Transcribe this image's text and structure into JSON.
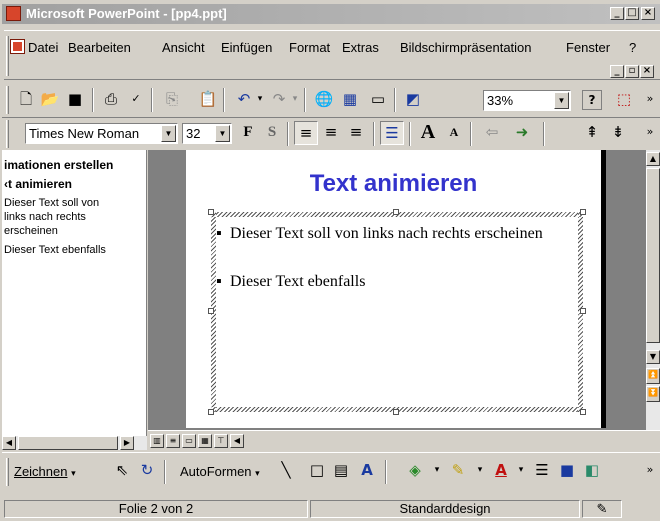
{
  "window": {
    "title": "Microsoft PowerPoint - [pp4.ppt]"
  },
  "menu": [
    {
      "label": "Datei"
    },
    {
      "label": "Bearbeiten"
    },
    {
      "label": "Ansicht"
    },
    {
      "label": "Einfügen"
    },
    {
      "label": "Format"
    },
    {
      "label": "Extras"
    },
    {
      "label": "Bildschirmpräsentation"
    },
    {
      "label": "Fenster"
    },
    {
      "label": "?"
    }
  ],
  "standard_toolbar": {
    "zoom": "33%"
  },
  "format_toolbar": {
    "font": "Times New Roman",
    "size": "32",
    "bold": "F",
    "shadow": "S"
  },
  "outline": {
    "title1": "imationen erstellen",
    "title2": "‹t animieren",
    "lines": [
      "Dieser Text soll von",
      "links nach rechts",
      "erscheinen",
      "Dieser Text ebenfalls"
    ]
  },
  "slide": {
    "title": "Text animieren",
    "bullets": [
      "Dieser Text soll von links nach rechts erscheinen",
      "Dieser Text ebenfalls"
    ]
  },
  "drawing_toolbar": {
    "draw_label": "Zeichnen",
    "autoshapes_label": "AutoFormen"
  },
  "status": {
    "slide": "Folie 2 von 2",
    "design": "Standarddesign"
  },
  "icons": [
    "new-icon",
    "open-icon",
    "save-icon",
    "print-icon",
    "spellcheck-icon",
    "copy-icon",
    "paste-icon",
    "undo-icon",
    "redo-icon",
    "hyperlink-icon",
    "table-icon",
    "chart-icon",
    "grayscale-icon",
    "help-icon",
    "pdf-icon"
  ],
  "colors": {
    "title_blue": "#3333cc",
    "title_bar": "#a0a0a0",
    "app_icon": "#d7452b"
  }
}
